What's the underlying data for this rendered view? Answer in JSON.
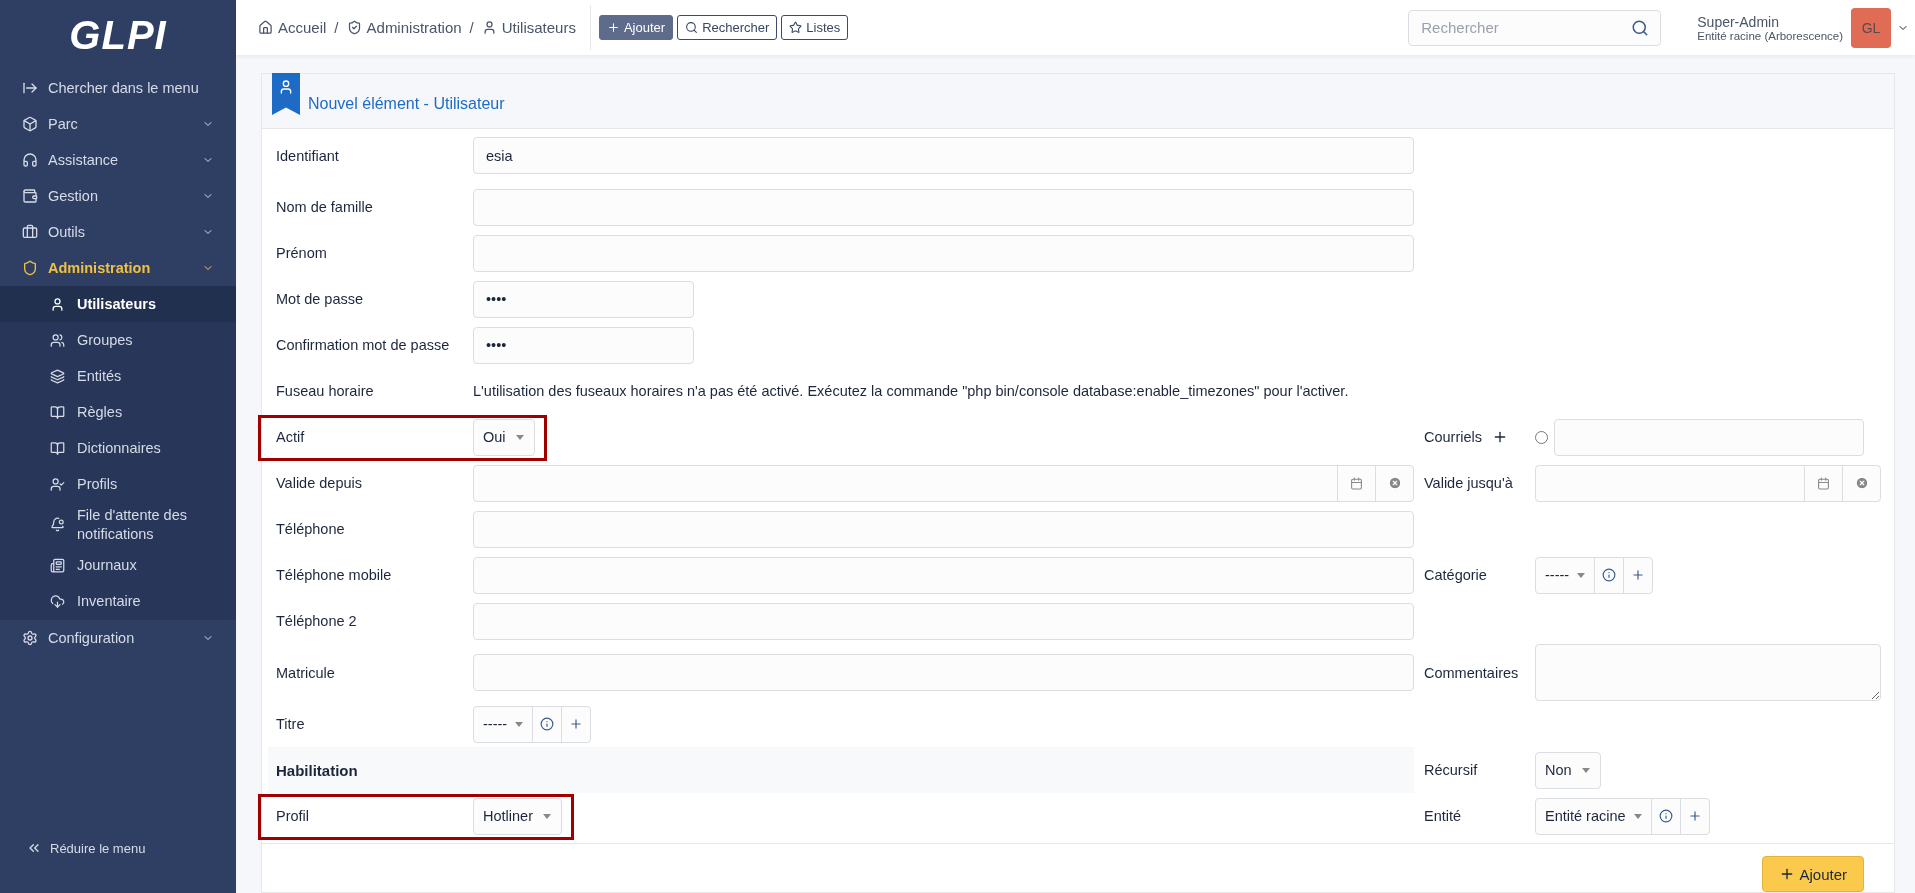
{
  "sidebar": {
    "logo": "GLPI",
    "search_link": "Chercher dans le menu",
    "items": [
      {
        "label": "Parc",
        "expanded": false
      },
      {
        "label": "Assistance",
        "expanded": false
      },
      {
        "label": "Gestion",
        "expanded": false
      },
      {
        "label": "Outils",
        "expanded": false
      },
      {
        "label": "Administration",
        "expanded": true,
        "children": [
          {
            "label": "Utilisateurs",
            "selected": true
          },
          {
            "label": "Groupes",
            "selected": false
          },
          {
            "label": "Entités",
            "selected": false
          },
          {
            "label": "Règles",
            "selected": false
          },
          {
            "label": "Dictionnaires",
            "selected": false
          },
          {
            "label": "Profils",
            "selected": false
          },
          {
            "label": "File d'attente des notifications",
            "selected": false
          },
          {
            "label": "Journaux",
            "selected": false
          },
          {
            "label": "Inventaire",
            "selected": false
          }
        ]
      },
      {
        "label": "Configuration",
        "expanded": false
      }
    ],
    "collapse": "Réduire le menu"
  },
  "header": {
    "breadcrumbs": [
      "Accueil",
      "Administration",
      "Utilisateurs"
    ],
    "separator": "/",
    "buttons": [
      {
        "label": "Ajouter",
        "kind": "primary"
      },
      {
        "label": "Rechercher",
        "kind": "outline"
      },
      {
        "label": "Listes",
        "kind": "outline"
      }
    ],
    "search": {
      "placeholder": "Rechercher"
    },
    "user": {
      "name": "Super-Admin",
      "entity": "Entité racine (Arborescence)",
      "initials": "GL",
      "color": "#e06c55"
    }
  },
  "card": {
    "title": "Nouvel élément - Utilisateur",
    "rows": [
      {
        "left": {
          "label": "Identifiant",
          "kind": "text",
          "value": "esia"
        }
      },
      {
        "left": {
          "label": "Nom de famille",
          "kind": "text"
        }
      },
      {
        "left": {
          "label": "Prénom",
          "kind": "text"
        }
      },
      {
        "left": {
          "label": "Mot de passe",
          "kind": "password",
          "value": "••••"
        }
      },
      {
        "left": {
          "label": "Confirmation mot de passe",
          "kind": "password",
          "value": "••••"
        }
      },
      {
        "left": {
          "label": "Fuseau horaire",
          "kind": "note",
          "value": "L'utilisation des fuseaux horaires n'a pas été activé. Exécutez la commande \"php bin/console database:enable_timezones\" pour l'activer."
        }
      },
      {
        "left": {
          "label": "Actif",
          "kind": "select",
          "value": "Oui",
          "highlighted": true
        },
        "right": {
          "label": "Courriels",
          "kind": "email",
          "default_selected": false
        }
      },
      {
        "left": {
          "label": "Valide depuis",
          "kind": "date"
        },
        "right": {
          "label": "Valide jusqu'à",
          "kind": "date"
        }
      },
      {
        "left": {
          "label": "Téléphone",
          "kind": "text"
        }
      },
      {
        "left": {
          "label": "Téléphone mobile",
          "kind": "text"
        },
        "right": {
          "label": "Catégorie",
          "kind": "dropdown",
          "value": "-----"
        }
      },
      {
        "left": {
          "label": "Téléphone 2",
          "kind": "text"
        }
      },
      {
        "left": {
          "label": "Matricule",
          "kind": "text"
        },
        "right": {
          "label": "Commentaires",
          "kind": "textarea"
        }
      },
      {
        "left": {
          "label": "Titre",
          "kind": "dropdown",
          "value": "-----"
        }
      },
      {
        "left": {
          "label": "Habilitation",
          "kind": "section"
        },
        "right": {
          "label": "Récursif",
          "kind": "select",
          "value": "Non"
        }
      },
      {
        "left": {
          "label": "Profil",
          "kind": "select",
          "value": "Hotliner",
          "highlighted": true
        },
        "right": {
          "label": "Entité",
          "kind": "dropdown",
          "value": "Entité racine"
        }
      }
    ],
    "submit": "Ajouter"
  }
}
